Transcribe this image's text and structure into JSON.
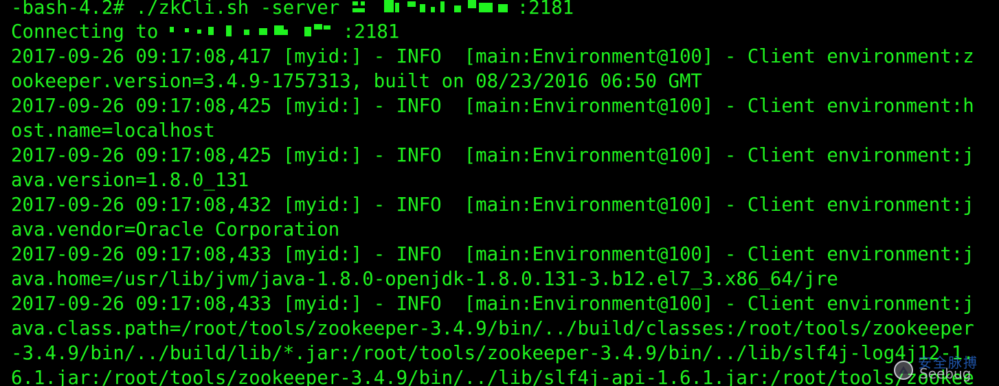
{
  "terminal": {
    "text_color": "#1ff21f",
    "background": "#000000",
    "prompt_line": {
      "command": "-bash-4.2# ./zkCli.sh -server ",
      "suffix": ":2181"
    },
    "connecting_line": {
      "prefix": "Connecting to ",
      "suffix": ":2181"
    },
    "log_lines": [
      "2017-09-26 09:17:08,417 [myid:] - INFO  [main:Environment@100] - Client environment:z",
      "ookeeper.version=3.4.9-1757313, built on 08/23/2016 06:50 GMT",
      "2017-09-26 09:17:08,425 [myid:] - INFO  [main:Environment@100] - Client environment:h",
      "ost.name=localhost",
      "2017-09-26 09:17:08,425 [myid:] - INFO  [main:Environment@100] - Client environment:j",
      "ava.version=1.8.0_131",
      "2017-09-26 09:17:08,432 [myid:] - INFO  [main:Environment@100] - Client environment:j",
      "ava.vendor=Oracle Corporation",
      "2017-09-26 09:17:08,433 [myid:] - INFO  [main:Environment@100] - Client environment:j",
      "ava.home=/usr/lib/jvm/java-1.8.0-openjdk-1.8.0.131-3.b12.el7_3.x86_64/jre",
      "2017-09-26 09:17:08,433 [myid:] - INFO  [main:Environment@100] - Client environment:j",
      "ava.class.path=/root/tools/zookeeper-3.4.9/bin/../build/classes:/root/tools/zookeeper",
      "-3.4.9/bin/../build/lib/*.jar:/root/tools/zookeeper-3.4.9/bin/../lib/slf4j-log4j12-1.",
      "6.1.jar:/root/tools/zookeeper-3.4.9/bin/../lib/slf4j-api-1.6.1.jar:/root/tools/zookee"
    ]
  },
  "watermark": {
    "cn_text": "安全脉搏",
    "en_text": "Seebug",
    "icon": "seebug-logo-icon"
  }
}
